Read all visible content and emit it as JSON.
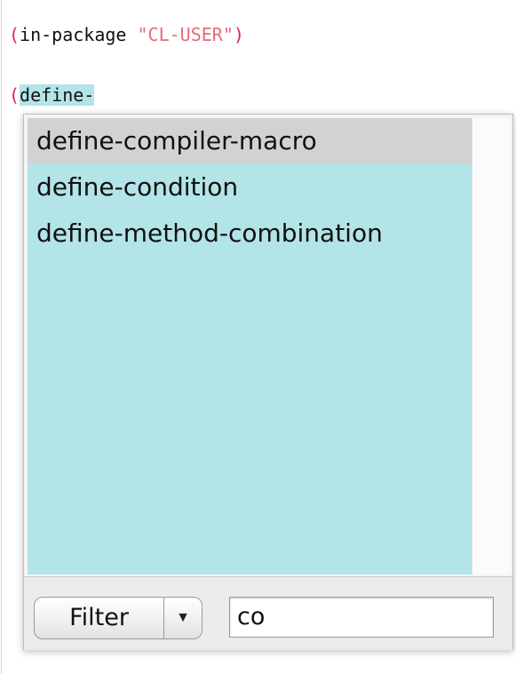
{
  "editor": {
    "line1": {
      "open_paren": "(",
      "symbol": "in-package ",
      "string": "\"CL-USER\"",
      "close_paren": ")"
    },
    "line2": {
      "open_paren": "(",
      "typed": "define-"
    }
  },
  "completion": {
    "items": [
      "define-compiler-macro",
      "define-condition",
      "define-method-combination"
    ],
    "selected_index": 0,
    "filter_mode": "Filter",
    "filter_dropdown_icon": "triangle-down",
    "filter_text": "co"
  },
  "colors": {
    "paren": "#e0245e",
    "string": "#e86a7b",
    "list_background": "#b3e4e8",
    "selected_background": "#d2d2d2"
  }
}
